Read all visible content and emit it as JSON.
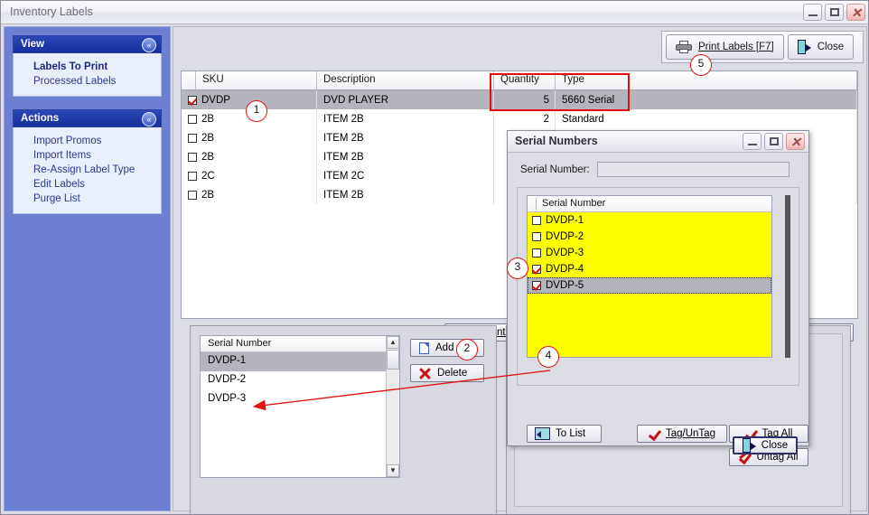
{
  "window": {
    "title": "Inventory Labels",
    "buttons": {
      "minimize": "minimize-icon",
      "maximize": "maximize-icon",
      "close": "close-icon",
      "close_glyph": "✕"
    }
  },
  "sidebar": {
    "groups": [
      {
        "title": "View",
        "collapse_glyph": "«",
        "items": [
          {
            "label": "Labels To Print",
            "selected": true
          },
          {
            "label": "Processed Labels",
            "selected": false
          }
        ]
      },
      {
        "title": "Actions",
        "collapse_glyph": "«",
        "items": [
          {
            "label": "Import Promos",
            "selected": false
          },
          {
            "label": "Import Items",
            "selected": false
          },
          {
            "label": "Re-Assign Label Type",
            "selected": false
          },
          {
            "label": "Edit Labels",
            "selected": false
          },
          {
            "label": "Purge List",
            "selected": false
          }
        ]
      }
    ]
  },
  "toolbar": {
    "print_label": "Print Labels [F7]",
    "print_icon": "printer-icon",
    "close_label": "Close",
    "close_icon": "exit-door-icon"
  },
  "grid": {
    "columns": [
      "",
      "SKU",
      "Description",
      "Quantity",
      "Type"
    ],
    "rows": [
      {
        "checked": true,
        "sku": "DVDP",
        "description": "DVD PLAYER",
        "quantity": "5",
        "type": "5660 Serial",
        "selected": true
      },
      {
        "checked": false,
        "sku": "2B",
        "description": "ITEM 2B",
        "quantity": "2",
        "type": "Standard",
        "selected": false
      },
      {
        "checked": false,
        "sku": "2B",
        "description": "ITEM 2B",
        "quantity": "",
        "type": "",
        "selected": false
      },
      {
        "checked": false,
        "sku": "2B",
        "description": "ITEM 2B",
        "quantity": "",
        "type": "",
        "selected": false
      },
      {
        "checked": false,
        "sku": "2C",
        "description": "ITEM 2C",
        "quantity": "",
        "type": "",
        "selected": false
      },
      {
        "checked": false,
        "sku": "2B",
        "description": "ITEM 2B",
        "quantity": "",
        "type": "",
        "selected": false
      }
    ]
  },
  "grid_actions": {
    "tag_untag": "Tag/Unta",
    "tag_untag_full": "Tag/UnTag",
    "delete": "Delete"
  },
  "serial_panel": {
    "column_header": "Serial Number",
    "rows": [
      {
        "value": "DVDP-1",
        "selected": true
      },
      {
        "value": "DVDP-2",
        "selected": false
      },
      {
        "value": "DVDP-3",
        "selected": false
      }
    ],
    "add_label": "Add",
    "add_icon": "new-page-icon",
    "delete_label": "Delete",
    "delete_icon": "red-x-icon",
    "scroll_up_glyph": "▲",
    "scroll_down_glyph": "▼"
  },
  "dialog": {
    "title": "Serial Numbers",
    "field_label": "Serial Number:",
    "field_value": "",
    "field_placeholder": "",
    "list_header": "Serial Number",
    "list_rows": [
      {
        "value": "DVDP-1",
        "checked": false,
        "selected": false
      },
      {
        "value": "DVDP-2",
        "checked": false,
        "selected": false
      },
      {
        "value": "DVDP-3",
        "checked": false,
        "selected": false
      },
      {
        "value": "DVDP-4",
        "checked": true,
        "selected": false
      },
      {
        "value": "DVDP-5",
        "checked": true,
        "selected": true
      }
    ],
    "to_list_label": "To List",
    "to_list_icon": "to-list-arrow-icon",
    "tag_untag_label": "Tag/UnTag",
    "tag_all_label": "Tag All",
    "untag_all_label": "Untag All",
    "close_label": "Close",
    "close_icon": "exit-door-icon",
    "buttons": {
      "minimize": "minimize-icon",
      "maximize": "maximize-icon",
      "close": "close-icon",
      "close_glyph": "✕"
    }
  },
  "callouts": [
    {
      "number": "1"
    },
    {
      "number": "2"
    },
    {
      "number": "3"
    },
    {
      "number": "4"
    },
    {
      "number": "5"
    }
  ],
  "colors": {
    "accent_blue": "#16309c",
    "sidebar_blue": "#6d7fd0",
    "highlight_yellow": "#ffff00",
    "callout_red": "#e01010",
    "selection_gray": "#b4b4bc"
  }
}
